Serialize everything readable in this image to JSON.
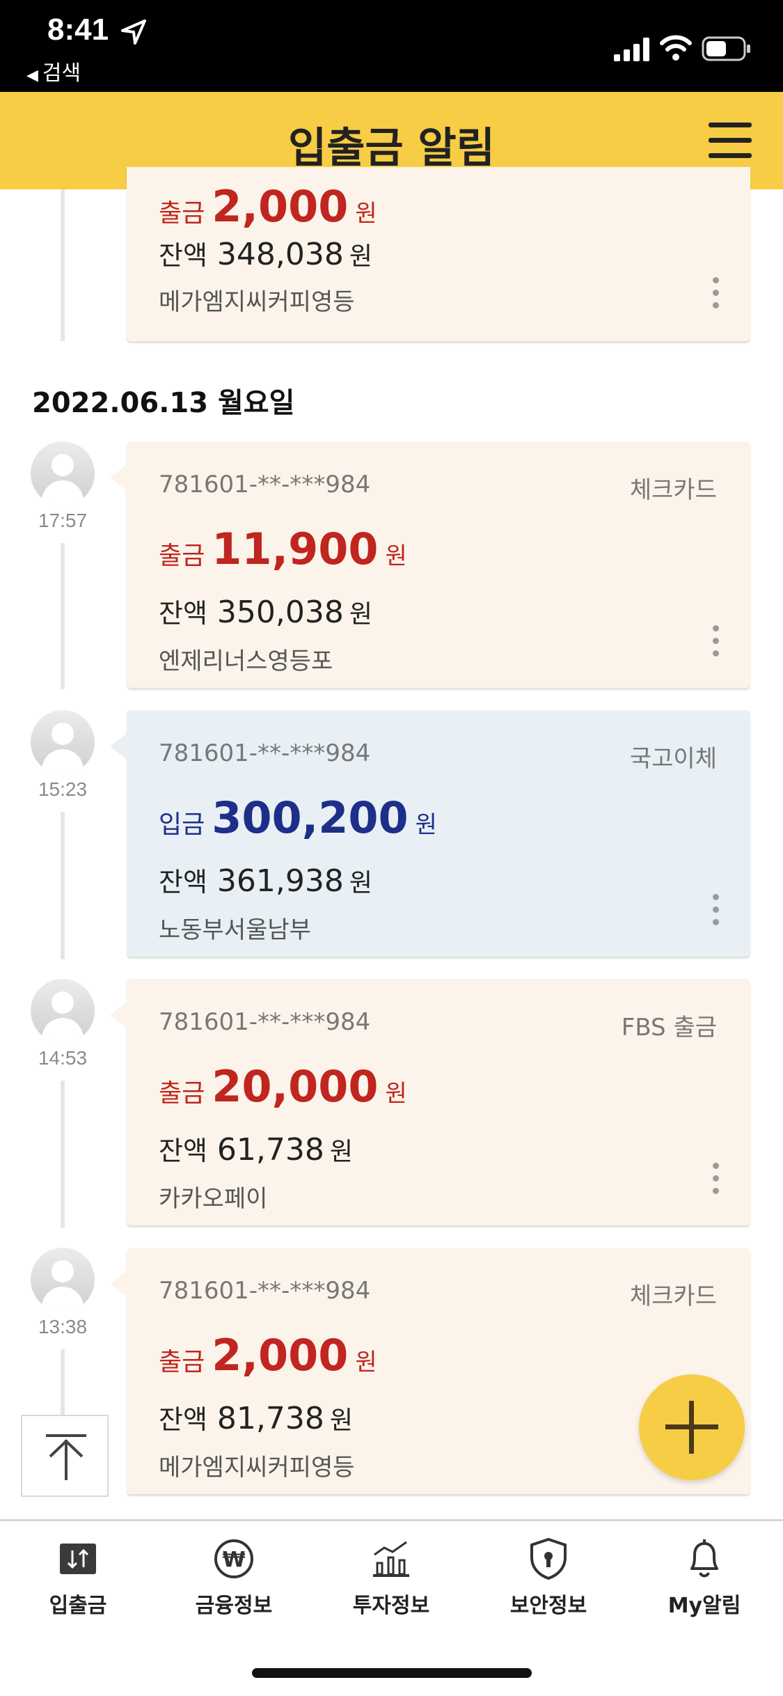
{
  "status_bar": {
    "time": "8:41",
    "back_label": "검색"
  },
  "header": {
    "title": "입출금 알림"
  },
  "top_partial": {
    "kind": "출금",
    "amount": "2,000",
    "unit": "원",
    "balance_label": "잔액",
    "balance": "348,038",
    "balance_unit": "원",
    "merchant": "메가엠지씨커피영등"
  },
  "date_header": "2022.06.13 월요일",
  "transactions": [
    {
      "time": "17:57",
      "account": "781601-**-***984",
      "type": "체크카드",
      "kind": "출금",
      "amount": "11,900",
      "unit": "원",
      "balance_label": "잔액",
      "balance": "350,038",
      "balance_unit": "원",
      "merchant": "엔제리너스영등포"
    },
    {
      "time": "15:23",
      "account": "781601-**-***984",
      "type": "국고이체",
      "kind": "입금",
      "amount": "300,200",
      "unit": "원",
      "balance_label": "잔액",
      "balance": "361,938",
      "balance_unit": "원",
      "merchant": "노동부서울남부"
    },
    {
      "time": "14:53",
      "account": "781601-**-***984",
      "type": "FBS 출금",
      "kind": "출금",
      "amount": "20,000",
      "unit": "원",
      "balance_label": "잔액",
      "balance": "61,738",
      "balance_unit": "원",
      "merchant": "카카오페이"
    },
    {
      "time": "13:38",
      "account": "781601-**-***984",
      "type": "체크카드",
      "kind": "출금",
      "amount": "2,000",
      "unit": "원",
      "balance_label": "잔액",
      "balance": "81,738",
      "balance_unit": "원",
      "merchant": "메가엠지씨커피영등"
    }
  ],
  "bottom_nav": [
    {
      "label": "입출금",
      "icon": "deposit-withdraw-icon"
    },
    {
      "label": "금융정보",
      "icon": "won-coin-icon"
    },
    {
      "label": "투자정보",
      "icon": "chart-icon"
    },
    {
      "label": "보안정보",
      "icon": "shield-lock-icon"
    },
    {
      "label": "My알림",
      "icon": "bell-icon"
    }
  ],
  "colors": {
    "header": "#f6cd45",
    "withdraw": "#c0251f",
    "deposit": "#1e2f8a",
    "withdraw_card": "#fcf4ea",
    "deposit_card": "#e8f0f5"
  }
}
